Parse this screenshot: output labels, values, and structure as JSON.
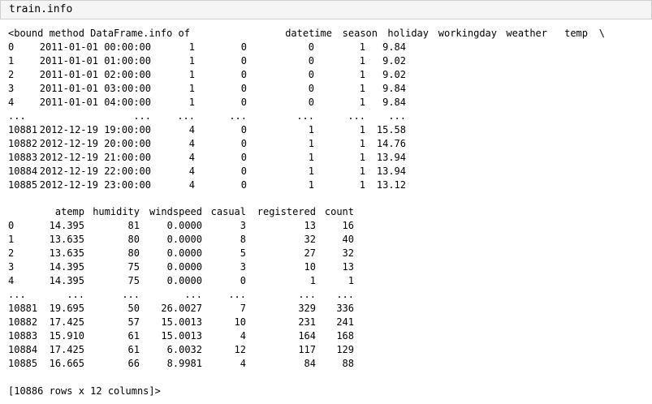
{
  "input": {
    "code": "train.info"
  },
  "block1": {
    "header_prefix": "<bound method DataFrame.info of",
    "headers": [
      "datetime",
      "season",
      "holiday",
      "workingday",
      "weather",
      "temp",
      "\\"
    ],
    "rows": [
      [
        "0",
        "2011-01-01 00:00:00",
        "1",
        "0",
        "0",
        "1",
        "9.84"
      ],
      [
        "1",
        "2011-01-01 01:00:00",
        "1",
        "0",
        "0",
        "1",
        "9.02"
      ],
      [
        "2",
        "2011-01-01 02:00:00",
        "1",
        "0",
        "0",
        "1",
        "9.02"
      ],
      [
        "3",
        "2011-01-01 03:00:00",
        "1",
        "0",
        "0",
        "1",
        "9.84"
      ],
      [
        "4",
        "2011-01-01 04:00:00",
        "1",
        "0",
        "0",
        "1",
        "9.84"
      ],
      [
        "...",
        "...",
        "...",
        "...",
        "...",
        "...",
        "..."
      ],
      [
        "10881",
        "2012-12-19 19:00:00",
        "4",
        "0",
        "1",
        "1",
        "15.58"
      ],
      [
        "10882",
        "2012-12-19 20:00:00",
        "4",
        "0",
        "1",
        "1",
        "14.76"
      ],
      [
        "10883",
        "2012-12-19 21:00:00",
        "4",
        "0",
        "1",
        "1",
        "13.94"
      ],
      [
        "10884",
        "2012-12-19 22:00:00",
        "4",
        "0",
        "1",
        "1",
        "13.94"
      ],
      [
        "10885",
        "2012-12-19 23:00:00",
        "4",
        "0",
        "1",
        "1",
        "13.12"
      ]
    ]
  },
  "block2": {
    "headers": [
      "atemp",
      "humidity",
      "windspeed",
      "casual",
      "registered",
      "count"
    ],
    "rows": [
      [
        "0",
        "14.395",
        "81",
        "0.0000",
        "3",
        "13",
        "16"
      ],
      [
        "1",
        "13.635",
        "80",
        "0.0000",
        "8",
        "32",
        "40"
      ],
      [
        "2",
        "13.635",
        "80",
        "0.0000",
        "5",
        "27",
        "32"
      ],
      [
        "3",
        "14.395",
        "75",
        "0.0000",
        "3",
        "10",
        "13"
      ],
      [
        "4",
        "14.395",
        "75",
        "0.0000",
        "0",
        "1",
        "1"
      ],
      [
        "...",
        "...",
        "...",
        "...",
        "...",
        "...",
        "..."
      ],
      [
        "10881",
        "19.695",
        "50",
        "26.0027",
        "7",
        "329",
        "336"
      ],
      [
        "10882",
        "17.425",
        "57",
        "15.0013",
        "10",
        "231",
        "241"
      ],
      [
        "10883",
        "15.910",
        "61",
        "15.0013",
        "4",
        "164",
        "168"
      ],
      [
        "10884",
        "17.425",
        "61",
        "6.0032",
        "12",
        "117",
        "129"
      ],
      [
        "10885",
        "16.665",
        "66",
        "8.9981",
        "4",
        "84",
        "88"
      ]
    ]
  },
  "footer": "[10886 rows x 12 columns]>"
}
